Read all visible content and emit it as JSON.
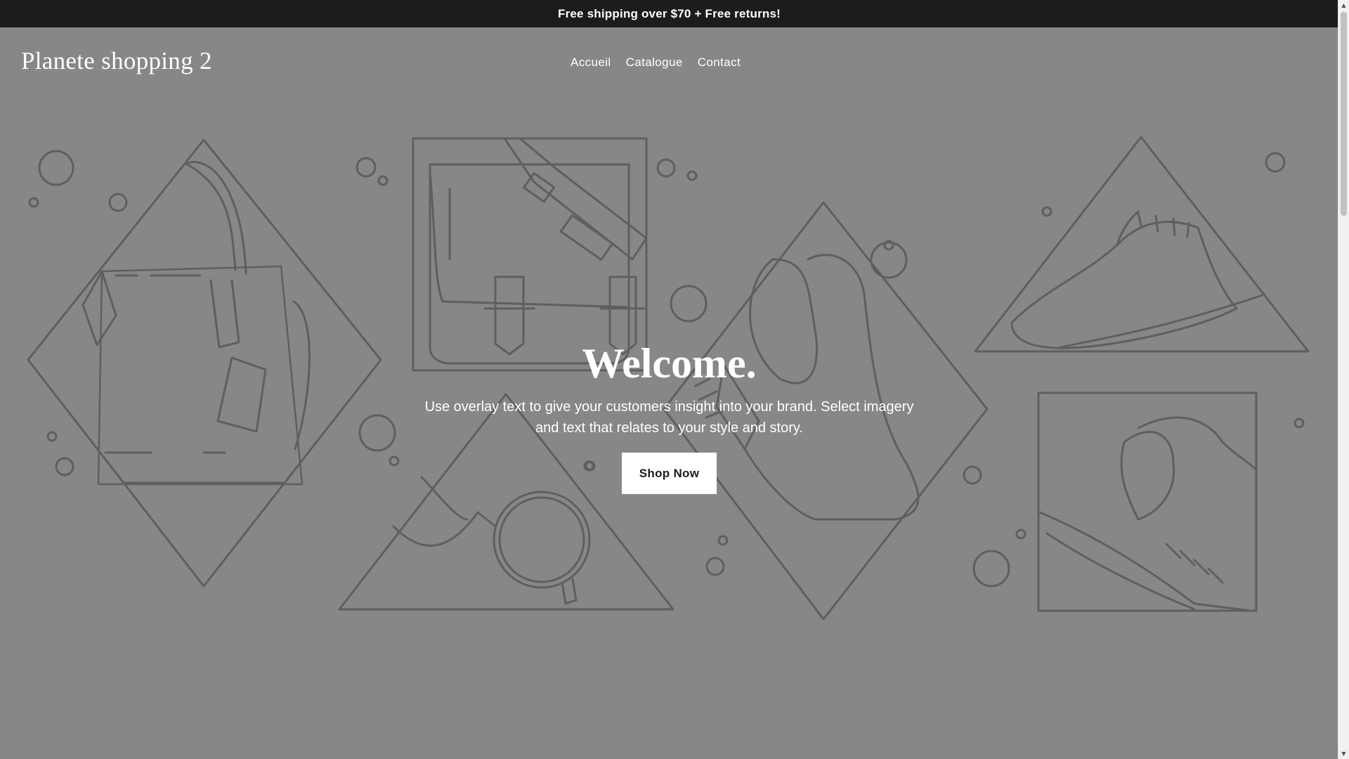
{
  "announcement": {
    "text": "Free shipping over $70 + Free returns!"
  },
  "header": {
    "logo": "Planete shopping 2",
    "nav": [
      {
        "label": "Accueil"
      },
      {
        "label": "Catalogue"
      },
      {
        "label": "Contact"
      }
    ]
  },
  "hero": {
    "title": "Welcome.",
    "text": "Use overlay text to give your customers insight into your brand. Select imagery and text that relates to your style and story.",
    "button_label": "Shop Now",
    "illustrations": [
      "handbag-icon",
      "messenger-bag-icon",
      "boot-icon",
      "brogue-shoe-icon",
      "sunglasses-icon",
      "feather-hat-icon"
    ]
  },
  "colors": {
    "announcement_bg": "#1c1c1c",
    "hero_bg": "#878787",
    "line_art": "#5f5f5f",
    "text": "#ffffff",
    "button_bg": "#ffffff",
    "button_text": "#1c1c1c"
  }
}
